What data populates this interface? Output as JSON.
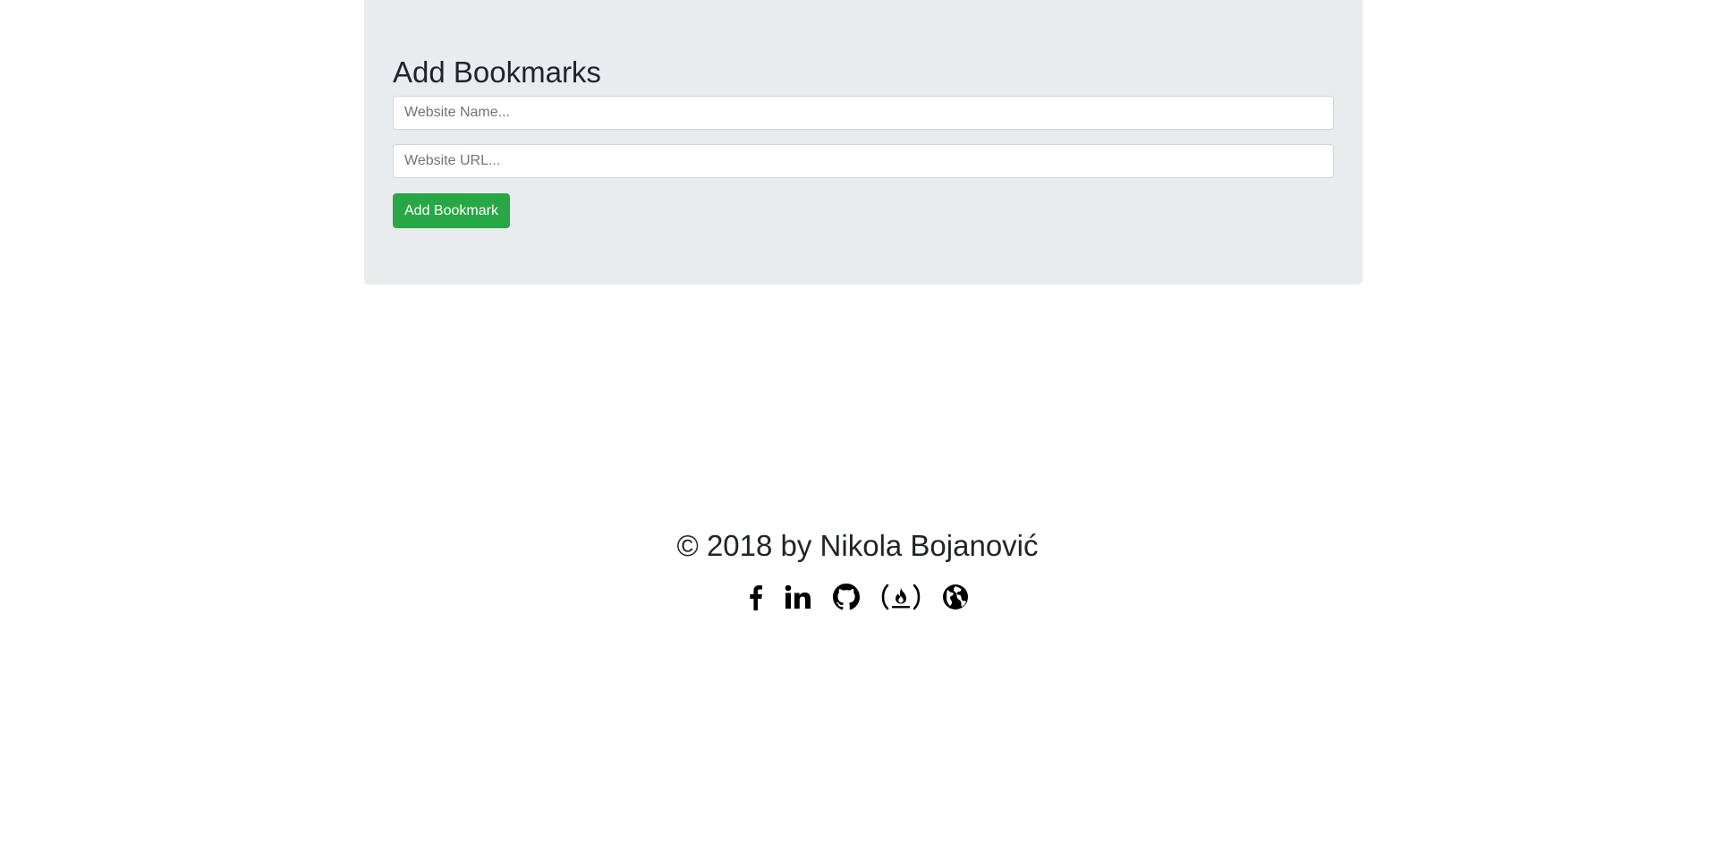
{
  "form": {
    "title": "Add Bookmarks",
    "name_placeholder": "Website Name...",
    "name_value": "",
    "url_placeholder": "Website URL...",
    "url_value": "",
    "submit_label": "Add Bookmark"
  },
  "footer": {
    "copyright": "© 2018 by Nikola Bojanović",
    "social_icons": [
      "facebook-icon",
      "linkedin-icon",
      "github-icon",
      "freecodecamp-icon",
      "website-globe-icon"
    ]
  },
  "colors": {
    "jumbotron_bg": "#e9ecef",
    "button_green": "#28a745",
    "text_dark": "#212529",
    "input_border": "#ced4da"
  }
}
